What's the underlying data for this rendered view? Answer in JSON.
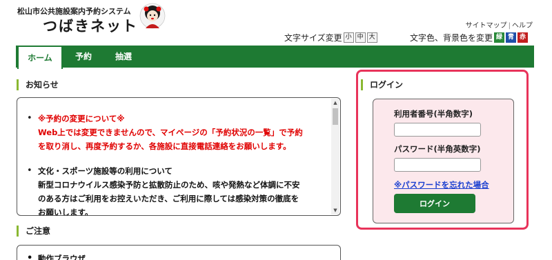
{
  "header": {
    "subtitle": "松山市公共施設案内予約システム",
    "title": "つばきネット",
    "links": {
      "sitemap": "サイトマップ",
      "help": "ヘルプ"
    },
    "font_size": {
      "label": "文字サイズ変更",
      "small": "小",
      "medium": "中",
      "large": "大"
    },
    "color_change": {
      "label": "文字色、背景色を変更",
      "options": [
        {
          "label": "緑",
          "color": "#2a8a3a"
        },
        {
          "label": "青",
          "color": "#1f4fa8"
        },
        {
          "label": "赤",
          "color": "#c21f1f"
        }
      ]
    }
  },
  "nav": {
    "items": [
      "ホーム",
      "予約",
      "抽選"
    ],
    "active": "ホーム",
    "color": "#1e7a33"
  },
  "notices": {
    "heading": "お知らせ",
    "items": [
      {
        "title": "※予約の変更について※",
        "lines": [
          "Web上では変更できませんので、マイページの「予約状況の一覧」で予約",
          "を取り消し、再度予約するか、各施設に直接電話連絡をお願いします。"
        ]
      },
      {
        "title": "文化・スポーツ施設等の利用について",
        "lines": [
          "新型コロナウイルス感染予防と拡散防止のため、咳や発熱など体調に不安",
          "のある方はご利用をお控えいただき、ご利用に際しては感染対策の徹底を",
          "お願いします。"
        ]
      }
    ]
  },
  "caution": {
    "heading": "ご注意",
    "first_item": "動作ブラウザ"
  },
  "login": {
    "heading": "ログイン",
    "user_id_label": "利用者番号(半角数字)",
    "user_id_value": "",
    "password_label": "パスワード(半角英数字)",
    "password_value": "",
    "forgot_link": "※パスワードを忘れた場合",
    "button": "ログイン",
    "accent": "#e8335a"
  }
}
